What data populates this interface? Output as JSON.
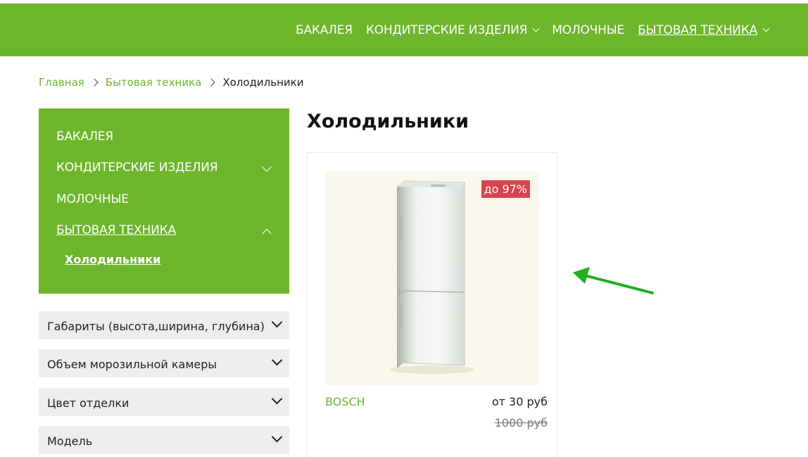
{
  "topnav": {
    "items": [
      {
        "label": "БАКАЛЕЯ",
        "has_dropdown": false,
        "active": false
      },
      {
        "label": "КОНДИТЕРСКИЕ ИЗДЕЛИЯ",
        "has_dropdown": true,
        "active": false
      },
      {
        "label": "МОЛОЧНЫЕ",
        "has_dropdown": false,
        "active": false
      },
      {
        "label": "БЫТОВАЯ ТЕХНИКА",
        "has_dropdown": true,
        "active": true
      }
    ]
  },
  "breadcrumb": {
    "home": "Главная",
    "category": "Бытовая техника",
    "current": "Холодильники"
  },
  "sidebar": {
    "items": [
      {
        "label": "БАКАЛЕЯ"
      },
      {
        "label": "КОНДИТЕРСКИЕ ИЗДЕЛИЯ",
        "expanded": false
      },
      {
        "label": "МОЛОЧНЫЕ"
      },
      {
        "label": "БЫТОВАЯ ТЕХНИКА",
        "expanded": true,
        "active": true
      }
    ],
    "subitem": "Холодильники"
  },
  "filters": [
    {
      "label": "Габариты (высота,ширина, глубина)"
    },
    {
      "label": "Объем морозильной камеры"
    },
    {
      "label": "Цвет отделки"
    },
    {
      "label": "Модель"
    }
  ],
  "page": {
    "title": "Холодильники"
  },
  "product": {
    "badge": "до 97%",
    "brand": "BOSCH",
    "price": "от 30 руб",
    "old_price": "1000 руб",
    "image_icon": "refrigerator-image"
  },
  "colors": {
    "brand_green": "#6db52b",
    "badge_red": "#d6444e",
    "filter_bg": "#ededed",
    "arrow_green": "#1fae1f"
  }
}
